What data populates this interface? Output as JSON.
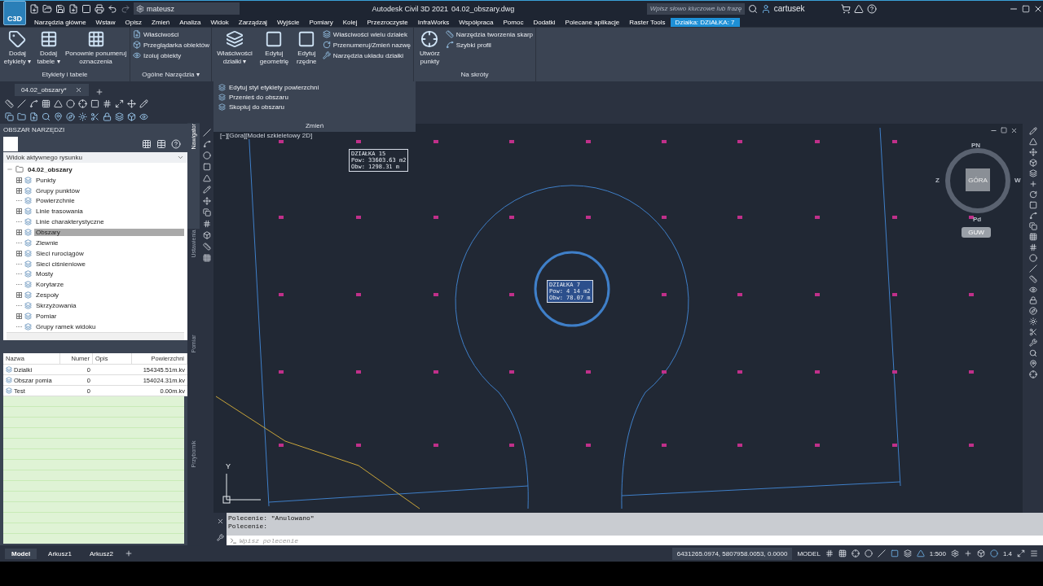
{
  "title_bar": {
    "logo": "C3D",
    "workspace": "mateusz",
    "app_title": "Autodesk Civil 3D 2021",
    "file_name": "04.02_obszary.dwg",
    "search": {
      "placeholder": "Wpisz słowo kluczowe lub frazę"
    },
    "user": "cartusek"
  },
  "ribbon_tabs": [
    {
      "label": "Narzędzia główne",
      "selected": false
    },
    {
      "label": "Wstaw",
      "selected": false
    },
    {
      "label": "Opisz",
      "selected": false
    },
    {
      "label": "Zmień",
      "selected": false
    },
    {
      "label": "Analiza",
      "selected": false
    },
    {
      "label": "Widok",
      "selected": false
    },
    {
      "label": "Zarządzaj",
      "selected": false
    },
    {
      "label": "Wyjście",
      "selected": false
    },
    {
      "label": "Pomiary",
      "selected": false
    },
    {
      "label": "Kolej",
      "selected": false
    },
    {
      "label": "Przezroczyste",
      "selected": false
    },
    {
      "label": "InfraWorks",
      "selected": false
    },
    {
      "label": "Współpraca",
      "selected": false
    },
    {
      "label": "Pomoc",
      "selected": false
    },
    {
      "label": "Dodatki",
      "selected": false
    },
    {
      "label": "Polecane aplikacje",
      "selected": false
    },
    {
      "label": "Raster Tools",
      "selected": false
    },
    {
      "label": "Działka: DZIAŁKA: 7",
      "selected": true
    }
  ],
  "ribbon_panels": [
    {
      "title": "Etykiety i tabele",
      "large_tools": [
        {
          "label": "Dodaj etykiety",
          "caret": "▾"
        },
        {
          "label": "Dodaj tabele",
          "caret": "▾"
        },
        {
          "label": "Ponownie ponumeruj oznaczenia"
        }
      ]
    },
    {
      "title": "Ogólne Narzędzia",
      "menu_caret": "▾",
      "small_tools": [
        "Właściwości",
        "Przeglądarka obiektów",
        "Izoluj obiekty"
      ]
    },
    {
      "large_tools": [
        {
          "label": "Właściwości działki",
          "caret": "▾"
        },
        {
          "label": "Edytuj geometrię"
        },
        {
          "label": "Edytuj rzędne"
        }
      ],
      "small_tools": [
        "Właściwości wielu działek",
        "Przenumeruj/Zmień nazwę",
        "Narzędzia układu działki"
      ]
    },
    {
      "title": "Na skróty",
      "large_tools": [
        {
          "label": "Utwórz punkty"
        }
      ],
      "small_tools": [
        "Narzędzia tworzenia skarp",
        "Szybki profil"
      ]
    }
  ],
  "dropdown_panel": {
    "title": "Zmień",
    "items": [
      "Edytuj styl etykiety powierzchni",
      "Przenieś do obszaru",
      "Skopiuj do obszaru"
    ]
  },
  "doc_tabs": [
    {
      "label": "04.02_obszary*",
      "selected": true
    }
  ],
  "toolspace": {
    "title": "OBSZAR NARZĘDZI",
    "view": "Widok aktywnego rysunku",
    "tree": {
      "label": "04.02_obszary",
      "children": [
        {
          "label": "Punkty",
          "expandable": true,
          "selected": false
        },
        {
          "label": "Grupy punktów",
          "expandable": true,
          "selected": false
        },
        {
          "label": "Powierzchnie",
          "expandable": false,
          "selected": false
        },
        {
          "label": "Linie trasowania",
          "expandable": true,
          "selected": false
        },
        {
          "label": "Linie charakterystyczne",
          "expandable": false,
          "selected": false
        },
        {
          "label": "Obszary",
          "expandable": true,
          "selected": true
        },
        {
          "label": "Zlewnie",
          "expandable": false,
          "selected": false
        },
        {
          "label": "Sieci rurociągów",
          "expandable": true,
          "selected": false
        },
        {
          "label": "Sieci ciśnieniowe",
          "expandable": false,
          "selected": false
        },
        {
          "label": "Mosty",
          "expandable": false,
          "selected": false
        },
        {
          "label": "Korytarze",
          "expandable": false,
          "selected": false
        },
        {
          "label": "Zespoły",
          "expandable": true,
          "selected": false
        },
        {
          "label": "Skrzyżowania",
          "expandable": false,
          "selected": false
        },
        {
          "label": "Pomiar",
          "expandable": true,
          "selected": false
        },
        {
          "label": "Grupy ramek widoku",
          "expandable": false,
          "selected": false
        }
      ]
    },
    "table": {
      "columns": [
        "Nazwa",
        "Numer",
        "Opis",
        "Powierzchni"
      ],
      "rows": [
        {
          "name": "Dzialki",
          "number": "0",
          "area": "154345.51m.kv"
        },
        {
          "name": "Obszar pomia",
          "number": "0",
          "area": "154024.31m.kv"
        },
        {
          "name": "Test",
          "number": "0",
          "area": "0.00m.kv"
        }
      ]
    }
  },
  "side_tabs": [
    {
      "label": "Nawigator",
      "selected": true
    },
    {
      "label": "Ustawienia",
      "selected": false
    },
    {
      "label": "Pomiar",
      "selected": false
    },
    {
      "label": "Przybornik",
      "selected": false
    }
  ],
  "canvas": {
    "viewport_label": "[−][Góra][Model szkieletowy 2D]",
    "parcel_labels": [
      {
        "lines": [
          "DZIAŁKA 15",
          "Pow: 33603.63 m2",
          "Obw: 1298.31 m"
        ],
        "selected": false
      },
      {
        "lines": [
          "DZIAŁKA 7",
          "Pow: 4 14 m2",
          "Obw: 78.07 m"
        ],
        "selected": true
      }
    ],
    "compass": {
      "north": "PN",
      "south": "Pd",
      "west": "Z",
      "east": "W",
      "top": "GÓRA",
      "ucs": "GUW"
    },
    "ucs_axis": "Y"
  },
  "command_line": {
    "history": [
      "Polecenie: \"Anulowano\"",
      "Polecenie:"
    ],
    "placeholder": "Wpisz polecenie"
  },
  "layout_tabs": [
    {
      "label": "Model",
      "selected": true
    },
    {
      "label": "Arkusz1",
      "selected": false
    },
    {
      "label": "Arkusz2",
      "selected": false
    }
  ],
  "status_bar": {
    "coordinates": "6431265.0974, 5807958.0053, 0.0000",
    "space": "MODEL",
    "scale": "1:500",
    "annotation": "1.4"
  }
}
